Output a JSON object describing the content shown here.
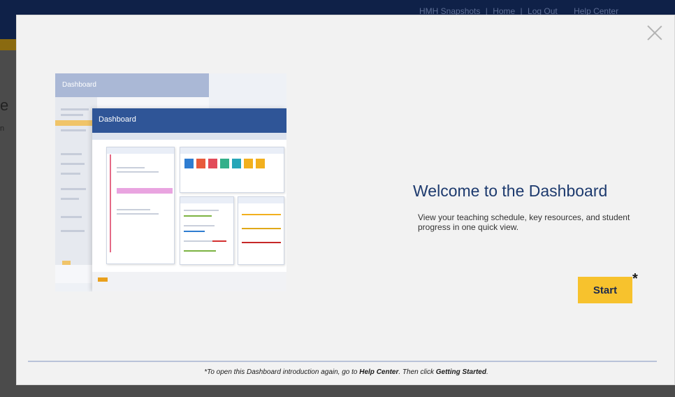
{
  "background": {
    "top_links": [
      "HMH Snapshots",
      "|",
      "Home",
      "|",
      "Log Out",
      "Help Center"
    ],
    "stub_text_1": "e",
    "stub_text_2": "n"
  },
  "modal": {
    "title": "Welcome to the Dashboard",
    "description": "View your teaching schedule, key resources, and student progress in one quick view.",
    "start_label": "Start",
    "asterisk": "*",
    "close_icon": "close-icon",
    "footer": {
      "prefix": "*To open this Dashboard introduction again, go to ",
      "link1": "Help Center",
      "middle": ". Then click ",
      "link2": "Getting Started",
      "suffix": "."
    }
  },
  "illustration": {
    "back_title": "Dashboard",
    "front_title": "Dashboard"
  },
  "colors": {
    "header_navy": "#0f2148",
    "accent_yellow": "#f7c22d",
    "title_blue": "#1d3a6e",
    "modal_bg": "#f2f2f2"
  }
}
